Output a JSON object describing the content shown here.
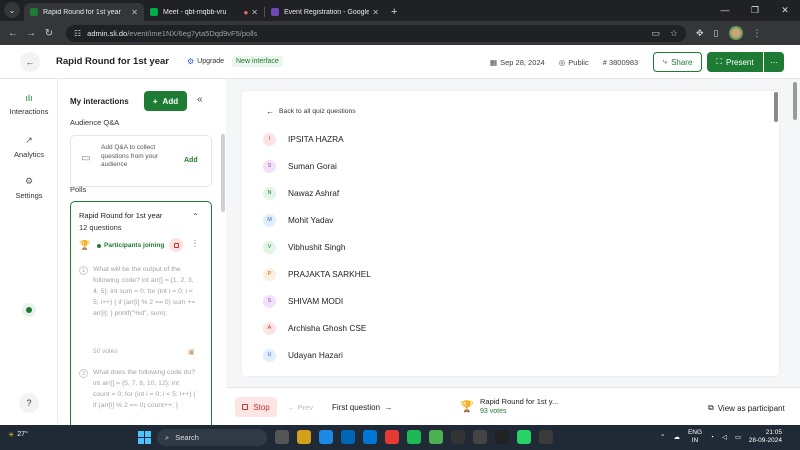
{
  "browser": {
    "tabs": [
      {
        "title": "Rapid Round for 1st year",
        "active": true,
        "favicon_color": "#1e7b34"
      },
      {
        "title": "Meet - qbt-mqbb-vru",
        "active": false,
        "favicon_color": "#00ac47"
      },
      {
        "title": "Event Registration - Google For",
        "active": false,
        "favicon_color": "#7248b9"
      }
    ],
    "url_host": "admin.sli.do",
    "url_path": "/event/ime1NX/6eg7yta5Dqd9vF5/polls"
  },
  "header": {
    "title": "Rapid Round for 1st year",
    "upgrade_label": "Upgrade",
    "new_interface_label": "New interface",
    "date": "Sep 28, 2024",
    "visibility": "Public",
    "event_code": "# 3800983",
    "share_label": "Share",
    "present_label": "Present"
  },
  "rail": {
    "items": [
      {
        "label": "Interactions",
        "icon": "bar-chart-icon"
      },
      {
        "label": "Analytics",
        "icon": "trend-icon"
      },
      {
        "label": "Settings",
        "icon": "gear-icon"
      }
    ],
    "help_label": "?"
  },
  "panel": {
    "title": "My interactions",
    "add_label": "Add",
    "qa_heading": "Audience Q&A",
    "qa_text": "Add Q&A to collect questions from your audience",
    "qa_add_label": "Add",
    "polls_heading": "Polls",
    "poll": {
      "name": "Rapid Round for 1st year",
      "count": "12 questions",
      "status": "Participants joining",
      "questions": [
        {
          "num": "1",
          "text": "What will be the output of the following code? int arr[] = {1, 2, 3, 4, 5}; int sum = 0; for (int i = 0; i < 5; i++) { if (arr[i] % 2 == 0) sum += arr[i]; } printf(\"%d\", sum);",
          "votes": "50 votes"
        },
        {
          "num": "2",
          "text": "What does the following code do? int arr[] = {5, 7, 8, 10, 12}; int count = 0; for (int i = 0; i < 5; i++) { if (arr[i] % 2 == 0) count++; }",
          "votes": ""
        }
      ]
    }
  },
  "main": {
    "back_label": "Back to all quiz questions",
    "participants": [
      {
        "initial": "I",
        "name": "IPSITA HAZRA",
        "bg": "#fde4e4",
        "fg": "#c0392b"
      },
      {
        "initial": "S",
        "name": "Suman Gorai",
        "bg": "#f1e2fb",
        "fg": "#8e44ad"
      },
      {
        "initial": "N",
        "name": "Nawaz Ashraf",
        "bg": "#e2f5e6",
        "fg": "#1e7b34"
      },
      {
        "initial": "M",
        "name": "Mohit Yadav",
        "bg": "#e1effd",
        "fg": "#2a6db5"
      },
      {
        "initial": "V",
        "name": "Vibhushit Singh",
        "bg": "#e2f5e6",
        "fg": "#1e7b34"
      },
      {
        "initial": "P",
        "name": "PRAJAKTA SARKHEL",
        "bg": "#fdeede",
        "fg": "#c06a1a"
      },
      {
        "initial": "S",
        "name": "SHIVAM MODI",
        "bg": "#f1e2fb",
        "fg": "#8e44ad"
      },
      {
        "initial": "A",
        "name": "Archisha Ghosh CSE",
        "bg": "#fde4e4",
        "fg": "#c0392b"
      },
      {
        "initial": "U",
        "name": "Udayan Hazari",
        "bg": "#e1effd",
        "fg": "#2a6db5"
      }
    ]
  },
  "footer": {
    "stop_label": "Stop",
    "prev_label": "Prev",
    "first_question_label": "First question",
    "poll_title": "Rapid Round for 1st y...",
    "votes": "93 votes",
    "view_label": "View as participant"
  },
  "taskbar": {
    "weather": "27°",
    "search_placeholder": "Search",
    "lang_top": "ENG",
    "lang_bottom": "IN",
    "time": "21:05",
    "date": "28-09-2024"
  },
  "colors": {
    "accent": "#1e7b34",
    "stop": "#c0392b",
    "chrome_dark": "#202124",
    "taskbar": "#1f2a36"
  }
}
